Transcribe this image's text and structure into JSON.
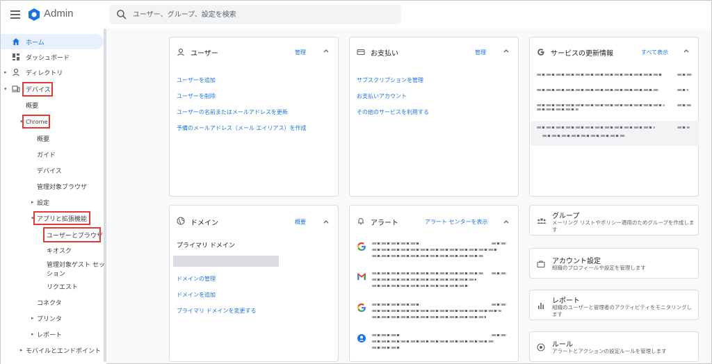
{
  "app": {
    "name": "Admin"
  },
  "search": {
    "placeholder": "ユーザー、グループ、設定を検索"
  },
  "sidebar": {
    "home": "ホーム",
    "dashboard": "ダッシュボード",
    "directory": "ディレクトリ",
    "devices": "デバイス",
    "overview": "概要",
    "chrome": "Chrome",
    "chrome_overview": "概要",
    "guide": "ガイド",
    "chrome_devices": "デバイス",
    "managed_browsers": "管理対象ブラウザ",
    "settings": "設定",
    "apps_extensions": "アプリと拡張機能",
    "users_browsers": "ユーザーとブラウザ",
    "kiosk": "キオスク",
    "managed_guest_1": "管理対象ゲスト セッ",
    "managed_guest_2": "ション",
    "requests": "リクエスト",
    "connectors": "コネクタ",
    "printers": "プリンタ",
    "reports": "レポート",
    "mobile_endpoints": "モバイルとエンドポイント"
  },
  "users_card": {
    "title": "ユーザー",
    "action": "管理",
    "links": [
      "ユーザーを追加",
      "ユーザーを削除",
      "ユーザーの名前またはメールアドレスを更新",
      "予備のメールアドレス（メール エイリアス）を作成"
    ]
  },
  "billing_card": {
    "title": "お支払い",
    "action": "管理",
    "links": [
      "サブスクリプションを管理",
      "お支払いアカウント",
      "その他のサービスを利用する"
    ]
  },
  "updates_card": {
    "title": "サービスの更新情報",
    "action": "すべて表示"
  },
  "domain_card": {
    "title": "ドメイン",
    "action": "概要",
    "primary_label": "プライマリ ドメイン",
    "links": [
      "ドメインの管理",
      "ドメインを追加",
      "プライマリ ドメインを変更する"
    ]
  },
  "alerts_card": {
    "title": "アラート",
    "action": "アラート センターを表示"
  },
  "groups_card": {
    "title": "グループ",
    "subtitle": "メーリング リストやポリシー適用のためグループを作成します"
  },
  "account_card": {
    "title": "アカウント設定",
    "subtitle": "組織のプロフィールや設定を管理します"
  },
  "reports_card": {
    "title": "レポート",
    "subtitle": "組織のユーザーと管理者のアクティビティをモニタリングします"
  },
  "rules_card": {
    "title": "ルール",
    "subtitle": "アラートとアクションの設定ルールを管理します"
  },
  "colors": {
    "accent": "#1a73e8",
    "highlight": "#e53935"
  }
}
